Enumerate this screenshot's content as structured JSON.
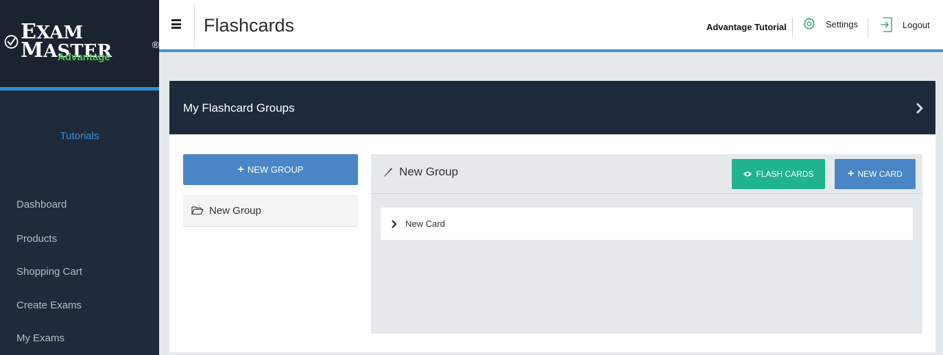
{
  "brand": {
    "name_first_letter": "E",
    "name_rest1": "XAM",
    "name_letter2": "M",
    "name_rest2": "ASTER",
    "registered": "®",
    "subtitle": "Advantage"
  },
  "sidebar": {
    "tutorials_label": "Tutorials",
    "items": [
      {
        "label": "Dashboard"
      },
      {
        "label": "Products"
      },
      {
        "label": "Shopping Cart"
      },
      {
        "label": "Create Exams"
      },
      {
        "label": "My Exams"
      }
    ]
  },
  "header": {
    "title": "Flashcards",
    "user_name": "Advantage Tutorial",
    "settings_label": "Settings",
    "logout_label": "Logout"
  },
  "groups_panel": {
    "title": "My Flashcard Groups",
    "new_group_label": "NEW GROUP",
    "groups": [
      {
        "label": "New Group"
      }
    ]
  },
  "group_detail": {
    "title": "New Group",
    "flash_cards_label": "FLASH CARDS",
    "new_card_label": "NEW CARD",
    "cards": [
      {
        "label": "New Card"
      }
    ]
  },
  "colors": {
    "sidebar_bg": "#1f2a3a",
    "accent_blue": "#2f8fd8",
    "brand_green": "#4fc34f",
    "button_blue": "#4a86c5",
    "button_green": "#1fb38e",
    "panel_header": "#1d2a3c"
  },
  "icons": {
    "logo": "checkmark-circle-icon",
    "menu": "hamburger-icon",
    "settings": "gear-icon",
    "logout": "logout-arrow-icon",
    "panel_toggle": "chevron-right-icon",
    "add": "plus-icon",
    "group": "folder-open-icon",
    "edit": "pencil-icon",
    "view": "eye-icon",
    "card_expand": "chevron-right-icon"
  }
}
